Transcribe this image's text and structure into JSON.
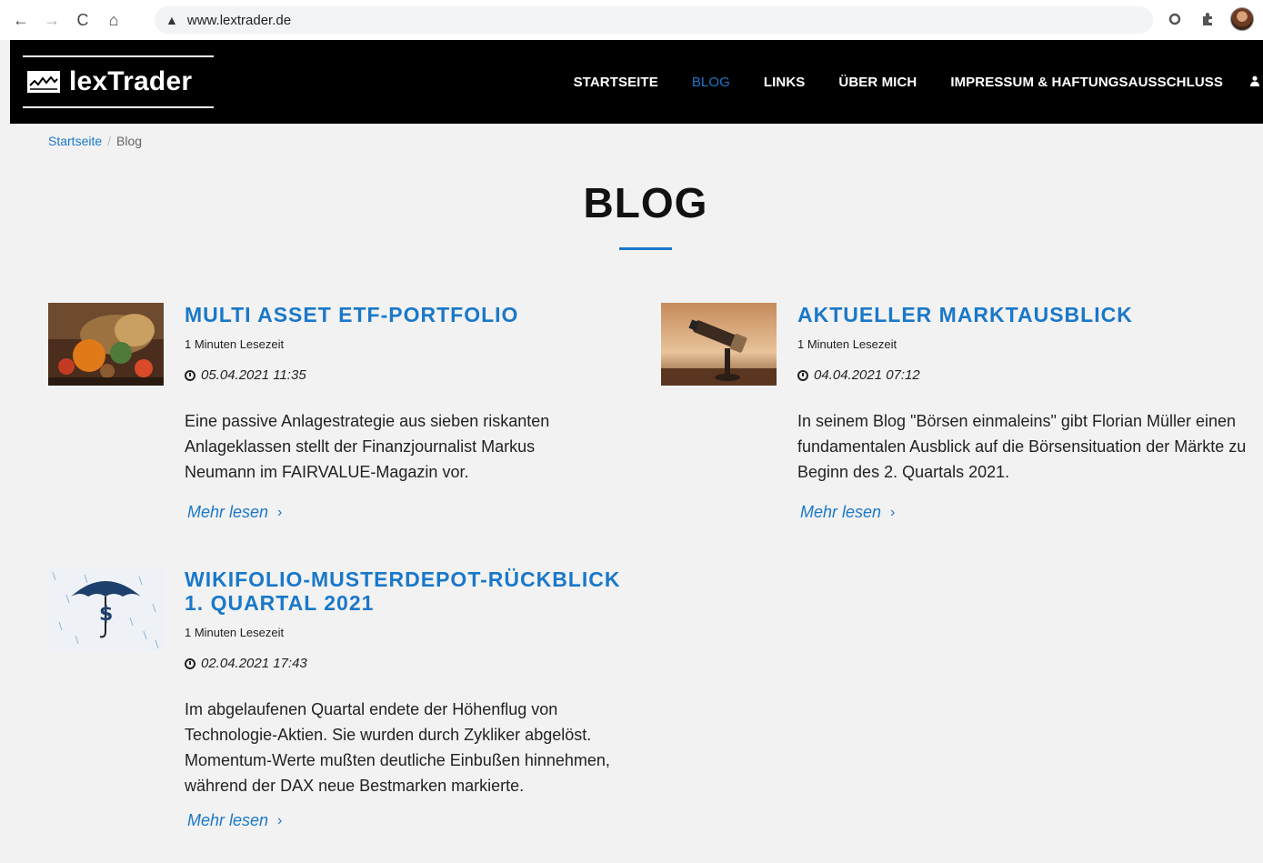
{
  "browser": {
    "back": "←",
    "forward": "→",
    "reload": "C",
    "home": "⌂",
    "warning_icon": "▲",
    "url": "www.lextrader.de"
  },
  "site": {
    "logo_text": "lexTrader",
    "nav": [
      {
        "label": "STARTSEITE",
        "active": false
      },
      {
        "label": "BLOG",
        "active": true
      },
      {
        "label": "LINKS",
        "active": false
      },
      {
        "label": "ÜBER MICH",
        "active": false
      },
      {
        "label": "IMPRESSUM & HAFTUNGSAUSSCHLUSS",
        "active": false
      }
    ],
    "accent_color": "#1a78c9"
  },
  "breadcrumb": {
    "home": "Startseite",
    "separator": "/",
    "current": "Blog"
  },
  "page": {
    "title": "BLOG"
  },
  "posts": [
    {
      "title": "MULTI ASSET ETF-PORTFOLIO",
      "reading_time": "1 Minuten Lesezeit",
      "date": "05.04.2021 11:35",
      "excerpt": "Eine passive Anlagestrategie aus sieben riskanten Anlageklassen stellt der Finanzjournalist Markus Neumann im FAIRVALUE-Magazin vor.",
      "read_more": "Mehr lesen"
    },
    {
      "title": "AKTUELLER MARKTAUSBLICK",
      "reading_time": "1 Minuten Lesezeit",
      "date": "04.04.2021 07:12",
      "excerpt": "In seinem Blog \"Börsen einmaleins\" gibt Florian Müller einen fundamentalen Ausblick auf die Börsensituation der Märkte zu Beginn des 2. Quartals 2021.",
      "read_more": "Mehr lesen"
    },
    {
      "title": "WIKIFOLIO-MUSTERDEPOT-RÜCKBLICK 1. QUARTAL 2021",
      "reading_time": "1 Minuten Lesezeit",
      "date": "02.04.2021 17:43",
      "excerpt": "Im abgelaufenen Quartal endete der Höhenflug von Technologie-Aktien. Sie wurden durch Zykliker abgelöst. Momentum-Werte mußten deutliche Einbußen hinnehmen, während der DAX neue Bestmarken markierte.",
      "read_more": "Mehr lesen"
    }
  ]
}
